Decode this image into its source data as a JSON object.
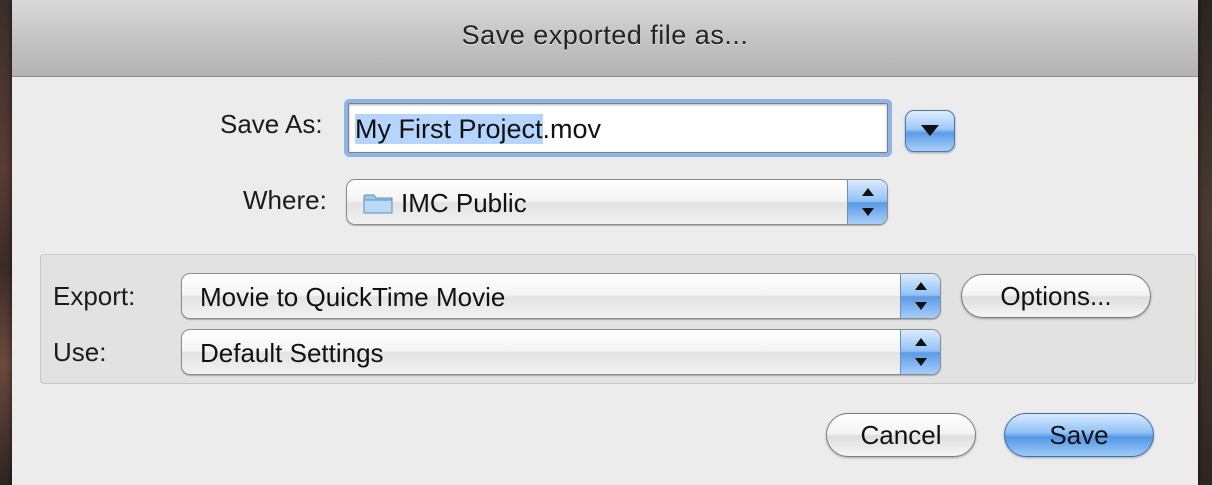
{
  "dialog": {
    "title": "Save exported file as..."
  },
  "save_as": {
    "label": "Save As:",
    "value_selected": "My First Project",
    "value_rest": ".mov"
  },
  "where": {
    "label": "Where:",
    "value": "IMC Public",
    "icon": "folder-icon"
  },
  "export": {
    "label": "Export:",
    "value": "Movie to QuickTime Movie",
    "options_label": "Options..."
  },
  "use": {
    "label": "Use:",
    "value": "Default Settings"
  },
  "buttons": {
    "cancel_label": "Cancel",
    "save_label": "Save"
  },
  "colors": {
    "accent": "#5b9be6",
    "selection": "#b5d5ff",
    "focus_ring": "#8fb5e8"
  }
}
